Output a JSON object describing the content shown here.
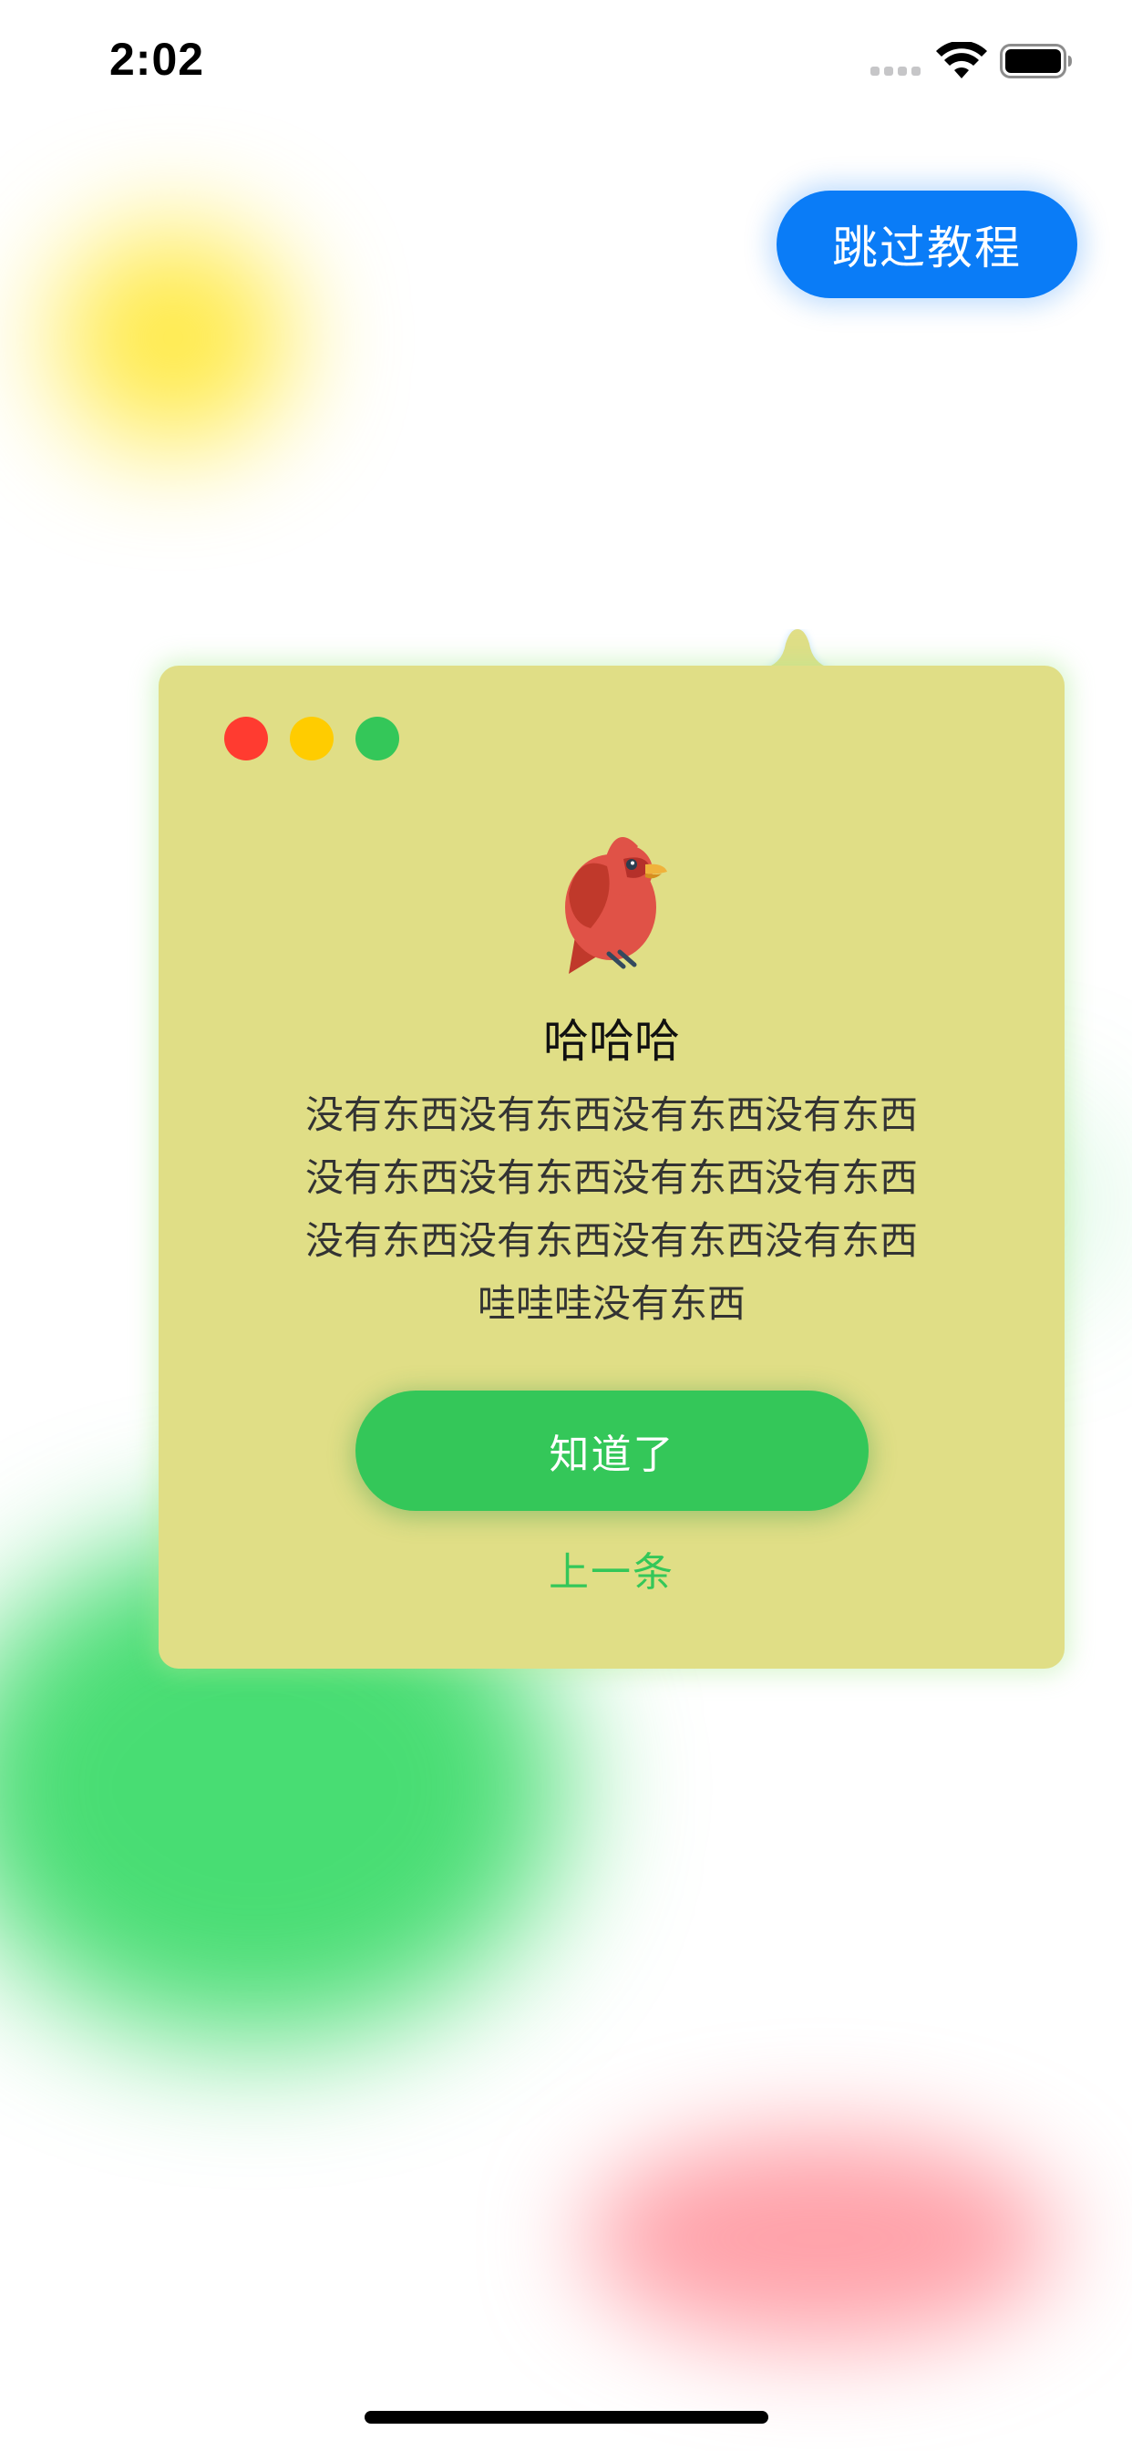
{
  "status_bar": {
    "time": "2:02",
    "icons": [
      "signal-dots-icon",
      "wifi-icon",
      "battery-icon"
    ]
  },
  "skip_button": {
    "label": "跳过教程",
    "color": "#0a7cf7"
  },
  "card": {
    "background": "#e0de86",
    "window_controls": [
      "close-dot",
      "minimize-dot",
      "zoom-dot"
    ],
    "icon": "cardinal-bird-icon",
    "title": "哈哈哈",
    "body": "没有东西没有东西没有东西没有东西\n没有东西没有东西没有东西没有东西\n没有东西没有东西没有东西没有东西\n哇哇哇没有东西",
    "primary_button": {
      "label": "知道了",
      "color": "#34c759"
    },
    "secondary_link": {
      "label": "上一条",
      "color": "#34c759"
    }
  },
  "colors": {
    "traffic_red": "#ff3b30",
    "traffic_yellow": "#ffcc00",
    "traffic_green": "#34c759"
  }
}
